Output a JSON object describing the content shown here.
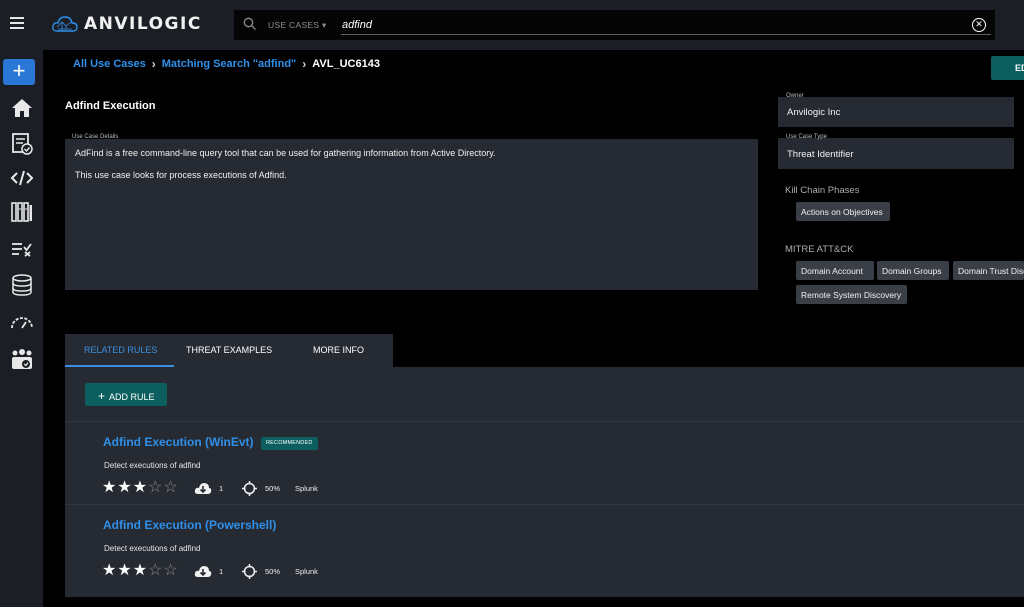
{
  "app": {
    "name": "ANVILOGIC"
  },
  "search": {
    "scope": "USE CASES",
    "value": "adfind"
  },
  "breadcrumbs": {
    "root": "All Use Cases",
    "search": "Matching Search \"adfind\"",
    "current": "AVL_UC6143"
  },
  "edit_button": "ED",
  "use_case": {
    "title": "Adfind Execution",
    "details_label": "Use Case Details",
    "details": [
      "AdFind is a free command-line query tool that can be used for gathering information from Active Directory.",
      "This use case looks for process executions of Adfind."
    ]
  },
  "owner": {
    "label": "Owner",
    "value": "Anvilogic Inc"
  },
  "use_case_type": {
    "label": "Use Case Type",
    "value": "Threat Identifier"
  },
  "kill_chain": {
    "label": "Kill Chain Phases",
    "chips": [
      "Actions on Objectives"
    ]
  },
  "mitre": {
    "label": "MITRE ATT&CK",
    "chips": [
      "Domain Account",
      "Domain Groups",
      "Domain Trust Discovery",
      "Remote System Discovery"
    ]
  },
  "tabs": [
    "RELATED RULES",
    "THREAT EXAMPLES",
    "MORE INFO"
  ],
  "add_rule_label": "ADD RULE",
  "rules": [
    {
      "title": "Adfind Execution (WinEvt)",
      "badge": "RECOMMENDED",
      "description": "Detect executions of adfind",
      "rating": 3,
      "max_rating": 5,
      "downloads": "1",
      "coverage": "50%",
      "platform": "Splunk"
    },
    {
      "title": "Adfind Execution (Powershell)",
      "badge": "",
      "description": "Detect executions of adfind",
      "rating": 3,
      "max_rating": 5,
      "downloads": "1",
      "coverage": "50%",
      "platform": "Splunk"
    }
  ],
  "icons": {
    "sidebar": [
      "add-icon",
      "home-icon",
      "checklist-icon",
      "code-icon",
      "library-icon",
      "tasks-icon",
      "database-icon",
      "gauge-icon",
      "team-icon"
    ]
  },
  "colors": {
    "accent": "#2f90ea",
    "teal": "#0d5f5f",
    "panel": "#262a32",
    "bar": "#1b1e24"
  }
}
